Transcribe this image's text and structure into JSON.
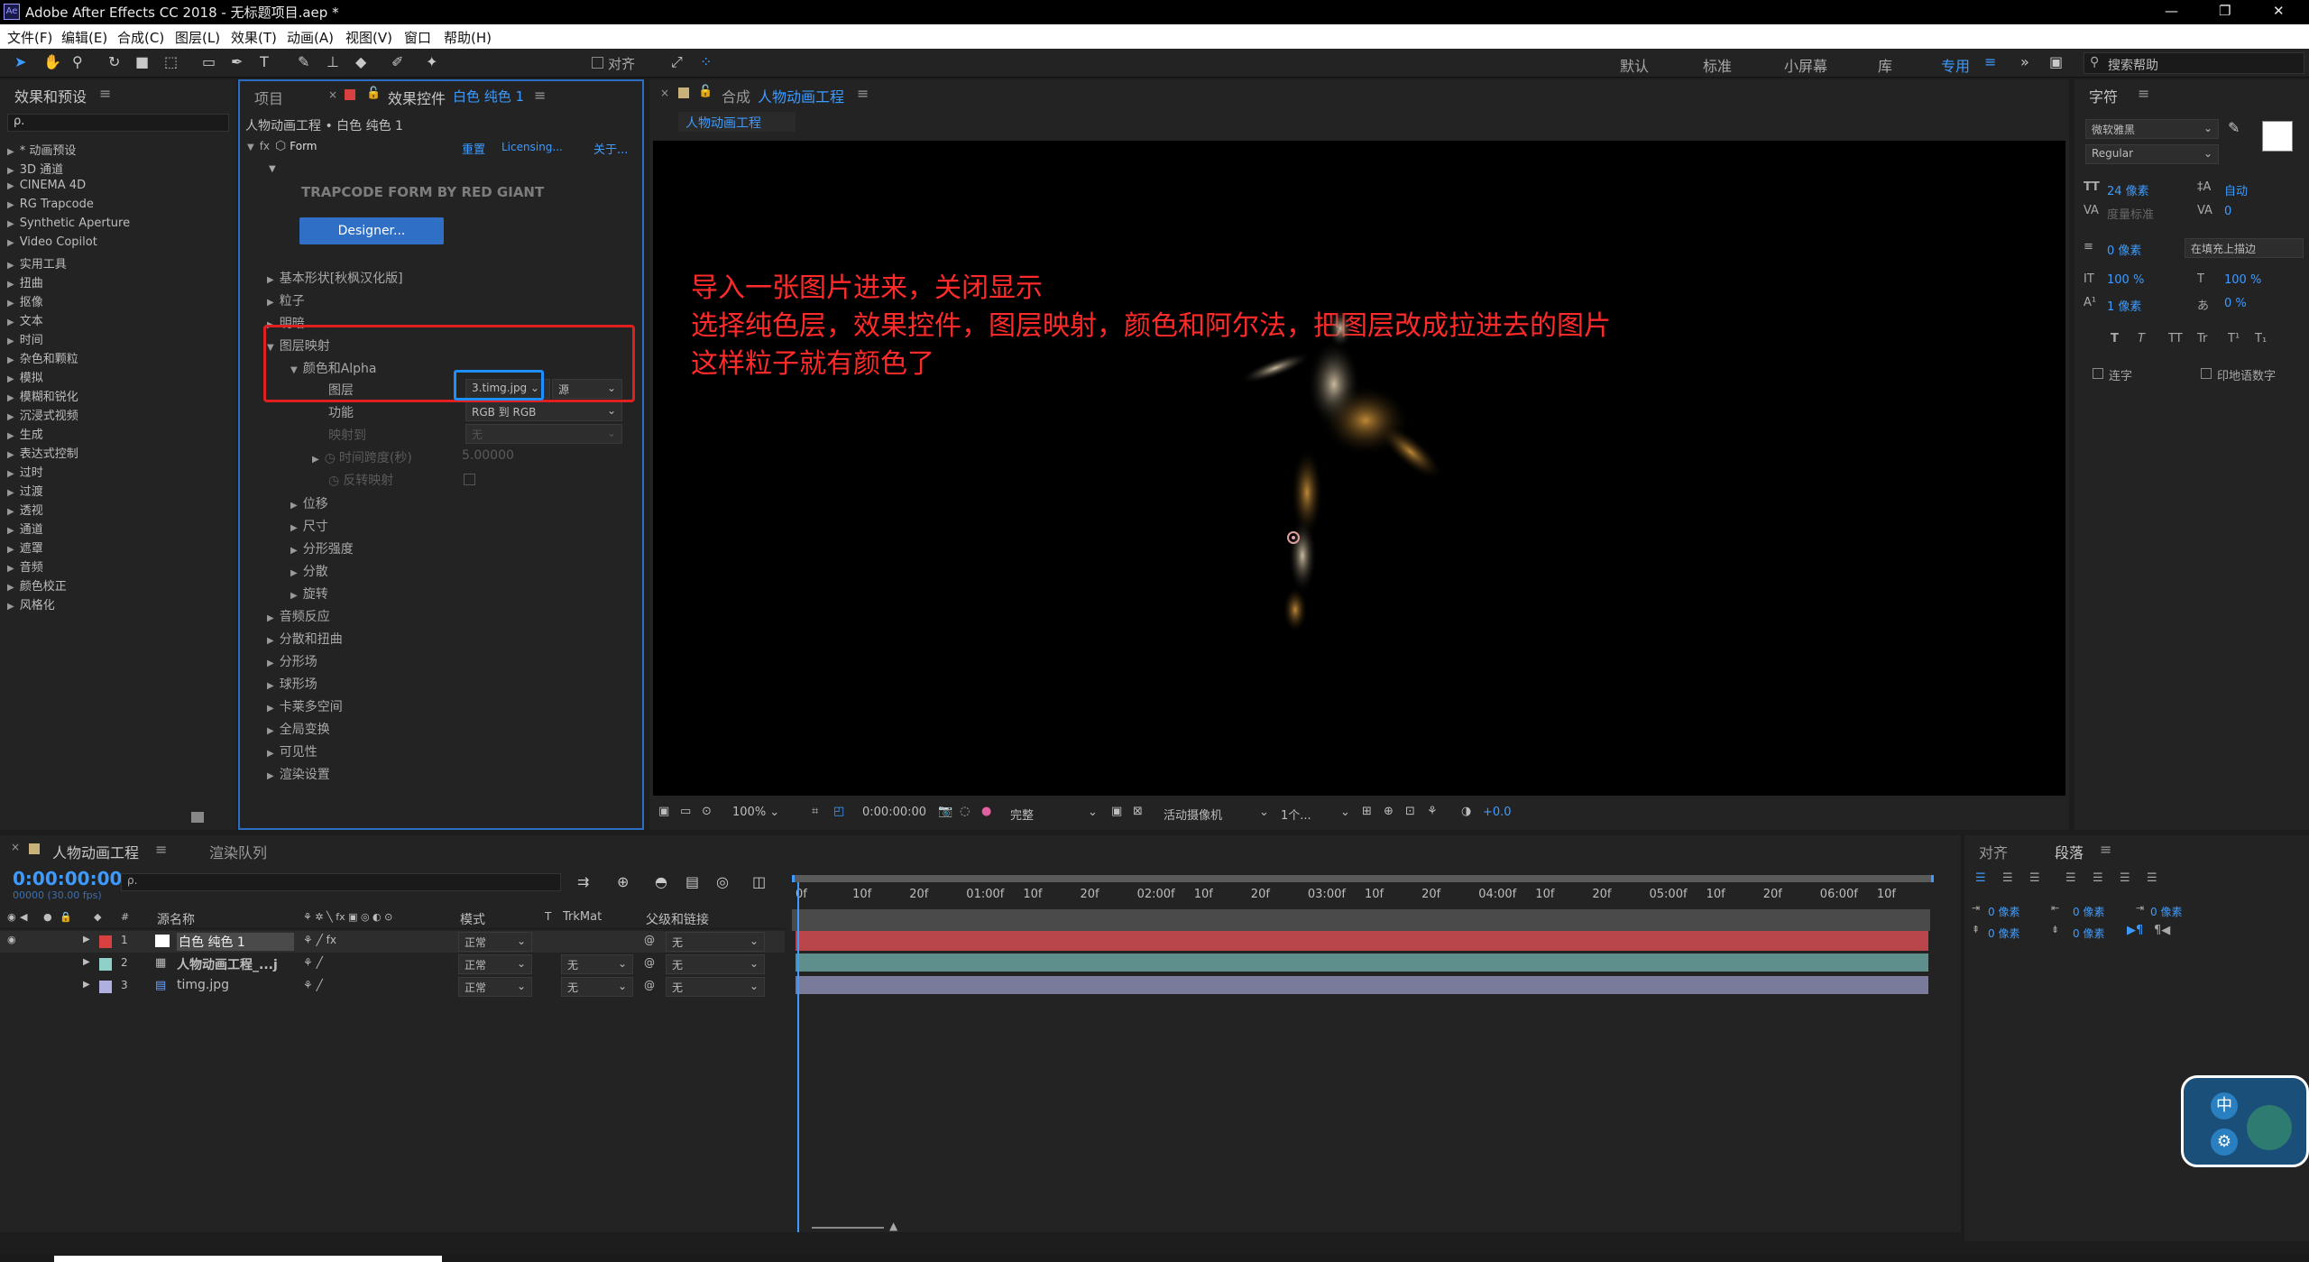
{
  "window": {
    "title": "Adobe After Effects CC 2018 - 无标题项目.aep *",
    "controls": [
      "—",
      "❐",
      "✕"
    ]
  },
  "menu": [
    "文件(F)",
    "编辑(E)",
    "合成(C)",
    "图层(L)",
    "效果(T)",
    "动画(A)",
    "视图(V)",
    "窗口",
    "帮助(H)"
  ],
  "toolbar": {
    "align_label": "对齐",
    "workspaces": [
      "默认",
      "标准",
      "小屏幕",
      "库",
      "专用"
    ],
    "search_placeholder": "搜索帮助"
  },
  "effects_panel": {
    "title": "效果和预设",
    "search": "ρ.",
    "items": [
      "* 动画预设",
      "3D 通道",
      "CINEMA 4D",
      "RG Trapcode",
      "Synthetic Aperture",
      "Video Copilot",
      "实用工具",
      "扭曲",
      "抠像",
      "文本",
      "时间",
      "杂色和颗粒",
      "模拟",
      "模糊和锐化",
      "沉浸式视频",
      "生成",
      "表达式控制",
      "过时",
      "过渡",
      "透视",
      "通道",
      "遮罩",
      "音频",
      "颜色校正",
      "风格化"
    ]
  },
  "effect_controls": {
    "tab_project": "项目",
    "tab_effect_prefix": "效果控件",
    "tab_layer": "白色 纯色 1",
    "breadcrumb": "人物动画工程 • 白色 纯色 1",
    "effect_name": "Form",
    "reset": "重置",
    "licensing": "Licensing...",
    "about": "关于...",
    "brand": "TRAPCODE FORM BY RED GIANT",
    "designer_button": "Designer...",
    "groups_top": [
      "基本形状[秋枫汉化版]",
      "粒子",
      "明暗"
    ],
    "layer_map": "图层映射",
    "color_alpha": "颜色和Alpha",
    "layer_label": "图层",
    "layer_value": "3.timg.jpg",
    "source_value": "源",
    "function_label": "功能",
    "function_value": "RGB 到 RGB",
    "map_to_label": "映射到",
    "map_to_value": "无",
    "time_span_label": "时间跨度(秒)",
    "time_span_value": "5.00000",
    "invert_label": "反转映射",
    "sub_groups": [
      "位移",
      "尺寸",
      "分形强度",
      "分散",
      "旋转"
    ],
    "groups_bottom": [
      "音频反应",
      "分散和扭曲",
      "分形场",
      "球形场",
      "卡莱多空间",
      "全局变换",
      "可见性",
      "渲染设置"
    ]
  },
  "composition": {
    "tab_label": "合成",
    "comp_name": "人物动画工程",
    "chip": "人物动画工程",
    "notes": [
      "导入一张图片进来，关闭显示",
      "选择纯色层，效果控件，图层映射，颜色和阿尔法，把图层改成拉进去的图片",
      "这样粒子就有颜色了"
    ],
    "footer": {
      "zoom": "100%",
      "timecode": "0:00:00:00",
      "quality": "完整",
      "camera": "活动摄像机",
      "views": "1个...",
      "exposure": "+0.0"
    }
  },
  "character": {
    "title": "字符",
    "font": "微软雅黑",
    "style": "Regular",
    "size": "24 像素",
    "leading": "自动",
    "kerning": "度量标准",
    "tracking": "0",
    "stroke": "0 像素",
    "stroke_mode": "在填充上描边",
    "vscale": "100 %",
    "hscale": "100 %",
    "baseline": "1 像素",
    "tsume": "0 %",
    "ligature": "连字",
    "hindi": "印地语数字",
    "styles": [
      "T",
      "T",
      "TT",
      "Tr",
      "T¹",
      "T₁"
    ]
  },
  "timeline": {
    "tab": "人物动画工程",
    "render_queue": "渲染队列",
    "timecode": "0:00:00:00",
    "frames": "00000 (30.00 fps)",
    "col_name": "源名称",
    "col_mode": "模式",
    "col_t": "T",
    "col_trkmat": "TrkMat",
    "col_parent": "父级和链接",
    "ruler": [
      "0f",
      "10f",
      "20f",
      "01:00f",
      "10f",
      "20f",
      "02:00f",
      "10f",
      "20f",
      "03:00f",
      "10f",
      "20f",
      "04:00f",
      "10f",
      "20f",
      "05:00f",
      "10f",
      "20f",
      "06:00f",
      "10f"
    ],
    "layers": [
      {
        "num": "1",
        "name": "白色 纯色 1",
        "mode": "正常",
        "trkmat": "",
        "parent": "无",
        "color": "#d94040",
        "bar": "#b8464b"
      },
      {
        "num": "2",
        "name": "人物动画工程_...j",
        "mode": "正常",
        "trkmat": "无",
        "parent": "无",
        "color": "#8fd0c8",
        "bar": "#5f8f8c"
      },
      {
        "num": "3",
        "name": "timg.jpg",
        "mode": "正常",
        "trkmat": "无",
        "parent": "无",
        "color": "#b0b0e0",
        "bar": "#7a7a9a"
      }
    ]
  },
  "paragraph": {
    "tab_align": "对齐",
    "tab_paragraph": "段落",
    "indent_values": [
      "0 像素",
      "0 像素",
      "0 像素",
      "0 像素",
      "0 像素"
    ]
  }
}
